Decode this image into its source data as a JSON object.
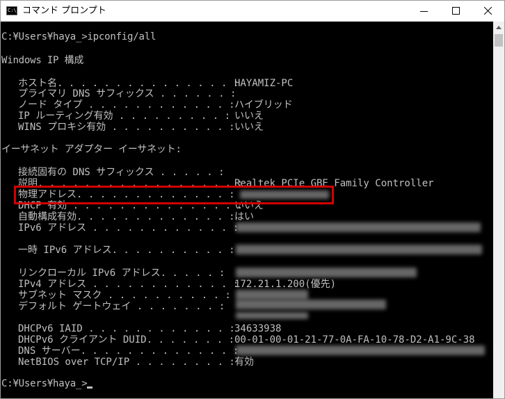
{
  "window": {
    "title": "コマンド プロンプト",
    "icon_text": "C:\\."
  },
  "console": {
    "prompt1": "C:¥Users¥haya_>ipconfig/all",
    "header": "Windows IP 構成",
    "host_label": "ホスト名. . . . . . . . . . . . . . . :",
    "host_value": "HAYAMIZ-PC",
    "dns_suffix_label": "プライマリ DNS サフィックス . . . . . . :",
    "node_label": "ノード タイプ . . . . . . . . . . . . :",
    "node_value": "ハイブリッド",
    "iprouting_label": "IP ルーティング有効 . . . . . . . . . :",
    "iprouting_value": "いいえ",
    "wins_label": "WINS プロキシ有効 . . . . . . . . . . :",
    "wins_value": "いいえ",
    "adapter_header": "イーサネット アダプター イーサネット:",
    "conn_dns_label": "接続固有の DNS サフィックス . . . . . :",
    "desc_label": "説明. . . . . . . . . . . . . . . . . :",
    "desc_value": "Realtek PCIe GBE Family Controller",
    "mac_label": "物理アドレス. . . . . . . . . . . . . :",
    "dhcp_label": "DHCP 有効 . . . . . . . . . . . . . . :",
    "dhcp_value": "いいえ",
    "autoconf_label": "自動構成有効. . . . . . . . . . . . . :",
    "autoconf_value": "はい",
    "ipv6_label": "IPv6 アドレス . . . . . . . . . . . . :",
    "tempipv6_label": "一時 IPv6 アドレス. . . . . . . . . . :",
    "linklocal_label": "リンクローカル IPv6 アドレス. . . . . :",
    "ipv4_label": "IPv4 アドレス . . . . . . . . . . . . :",
    "ipv4_value": "172.21.1.200(優先)",
    "subnet_label": "サブネット マスク . . . . . . . . . . :",
    "gateway_label": "デフォルト ゲートウェイ . . . . . . . :",
    "iaid_label": "DHCPv6 IAID . . . . . . . . . . . . :",
    "iaid_value": "34633938",
    "duid_label": "DHCPv6 クライアント DUID. . . . . . . :",
    "duid_value": "00-01-00-01-21-77-0A-FA-10-78-D2-A1-9C-38",
    "dnsserver_label": "DNS サーバー. . . . . . . . . . . . . :",
    "netbios_label": "NetBIOS over TCP/IP . . . . . . . . :",
    "netbios_value": "有効",
    "prompt2": "C:¥Users¥haya_>"
  },
  "colors": {
    "console_bg": "#000000",
    "console_text": "#c0c0c0",
    "highlight": "#d40000"
  }
}
